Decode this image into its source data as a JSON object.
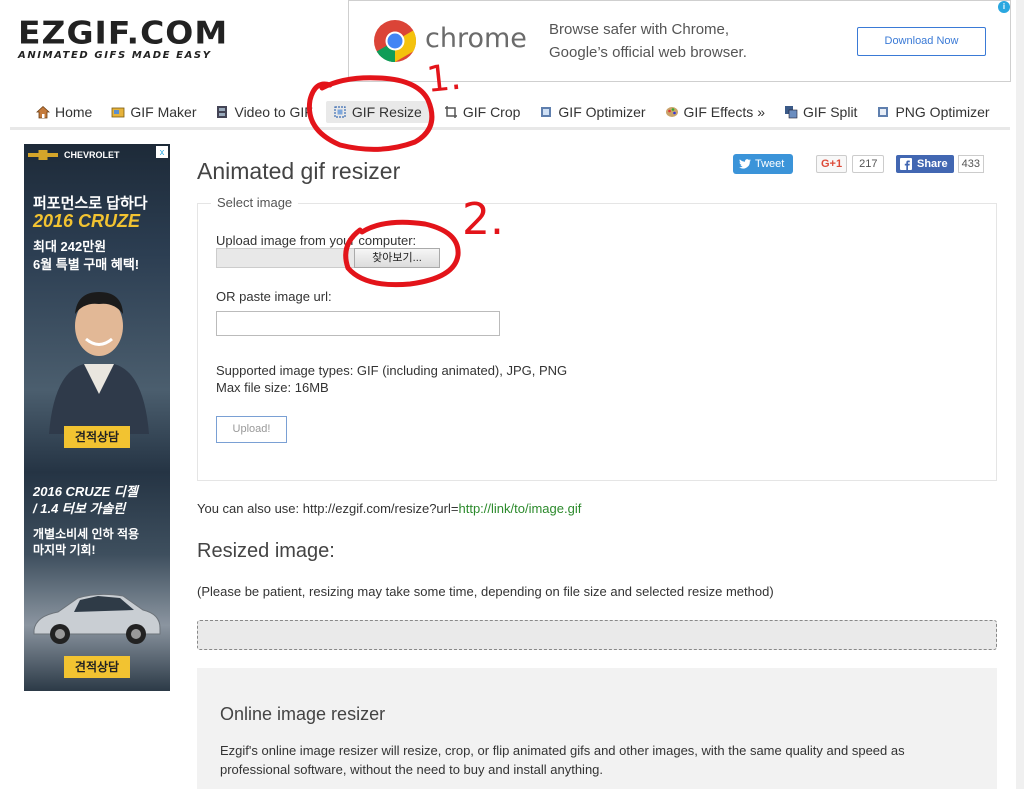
{
  "logo": {
    "main": "EZGIF.COM",
    "tagline": "ANIMATED GIFS MADE EASY"
  },
  "top_ad": {
    "brand": "chrome",
    "line1": "Browse safer with Chrome,",
    "line2": "Google’s official web browser.",
    "button": "Download Now",
    "adchoices": "i",
    "colors": {
      "red": "#db4437",
      "yellow": "#f4c20d",
      "green": "#0f9d58",
      "blue": "#4285f4"
    }
  },
  "nav": {
    "items": [
      {
        "label": "Home",
        "icon": "home-icon"
      },
      {
        "label": "GIF Maker",
        "icon": "gif-maker-icon"
      },
      {
        "label": "Video to GIF",
        "icon": "film-icon"
      },
      {
        "label": "GIF Resize",
        "icon": "resize-icon",
        "active": true
      },
      {
        "label": "GIF Crop",
        "icon": "crop-icon"
      },
      {
        "label": "GIF Optimizer",
        "icon": "optimizer-icon"
      },
      {
        "label": "GIF Effects »",
        "icon": "effects-icon"
      },
      {
        "label": "GIF Split",
        "icon": "split-icon"
      },
      {
        "label": "PNG Optimizer",
        "icon": "png-icon"
      }
    ]
  },
  "side_ad": {
    "brand": "CHEVROLET",
    "line1": "퍼포먼스로 답하다",
    "line2": "2016 CRUZE",
    "line3a": "최대 242만원",
    "line3b": "6월 특별 구매 혜택!",
    "button1": "견적상담",
    "line4a": "2016 CRUZE 디젤",
    "line4b": "/ 1.4 터보 가솔린",
    "line5a": "개별소비세 인하 적용",
    "line5b": "마지막 기회!",
    "button2": "견적상담",
    "close": "x"
  },
  "page": {
    "title": "Animated gif resizer",
    "tweet": "Tweet",
    "gplus": "G+1",
    "gplus_count": "217",
    "share": "Share",
    "share_count": "433"
  },
  "form": {
    "legend": "Select image",
    "upload_label": "Upload image from your computer:",
    "browse_button": "찾아보기...",
    "url_label": "OR paste image url:",
    "url_value": "",
    "types": "Supported image types: GIF (including animated), JPG, PNG",
    "max_size": "Max file size: 16MB",
    "upload_button": "Upload!"
  },
  "also": {
    "prefix": "You can also use: http://ezgif.com/resize?url=",
    "link": "http://link/to/image.gif"
  },
  "resized": {
    "title": "Resized image:",
    "note": "(Please be patient, resizing may take some time, depending on file size and selected resize method)"
  },
  "info": {
    "title": "Online image resizer",
    "text": "Ezgif's online image resizer will resize, crop, or flip animated gifs and other images, with the same quality and speed as professional software, without the need to buy and install anything."
  },
  "annotations": {
    "mark1": "1.",
    "mark2": "2.",
    "color": "#e3141a"
  }
}
